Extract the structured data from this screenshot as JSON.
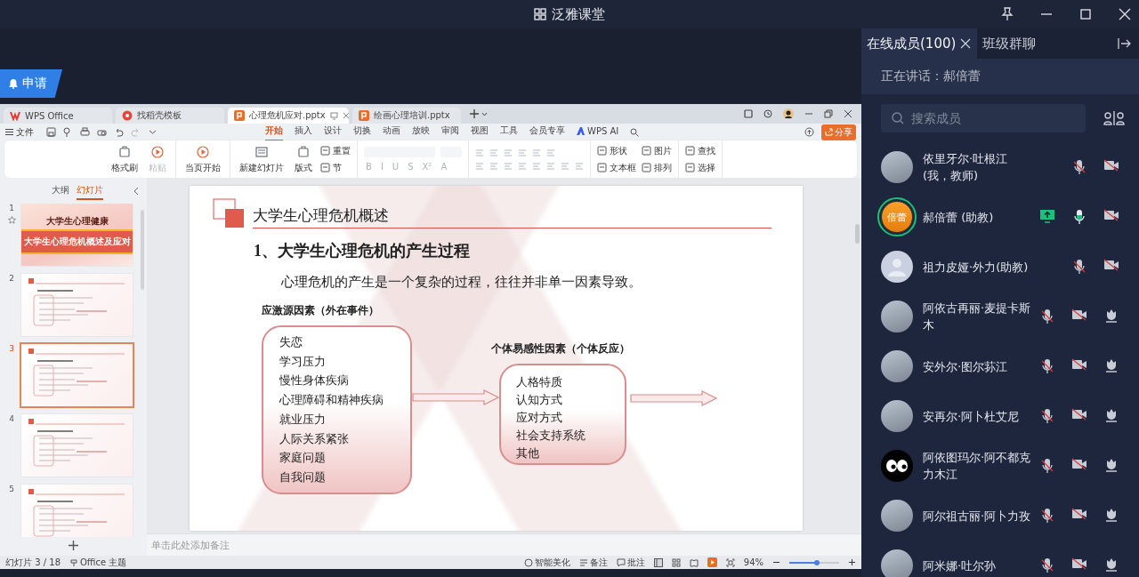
{
  "window": {
    "title": "泛雅课堂"
  },
  "apply_button": {
    "label": "申请"
  },
  "wps": {
    "tabs": [
      {
        "label": "WPS Office",
        "kind": "home",
        "selected": false
      },
      {
        "label": "找稻壳模板",
        "kind": "template",
        "selected": false
      },
      {
        "label": "心理危机应对.pptx",
        "kind": "pptx",
        "selected": true
      },
      {
        "label": "绘画心理培训.pptx",
        "kind": "pptx",
        "selected": false
      }
    ],
    "file_menu": {
      "label": "文件"
    },
    "ribbon_tabs": [
      {
        "label": "开始",
        "kind": "text",
        "selected": true
      },
      {
        "label": "插入",
        "kind": "text",
        "selected": false
      },
      {
        "label": "设计",
        "kind": "text",
        "selected": false
      },
      {
        "label": "切换",
        "kind": "text",
        "selected": false
      },
      {
        "label": "动画",
        "kind": "text",
        "selected": false
      },
      {
        "label": "放映",
        "kind": "text",
        "selected": false
      },
      {
        "label": "审阅",
        "kind": "text",
        "selected": false
      },
      {
        "label": "视图",
        "kind": "text",
        "selected": false
      },
      {
        "label": "工具",
        "kind": "text",
        "selected": false
      },
      {
        "label": "会员专享",
        "kind": "text",
        "selected": false
      },
      {
        "label": "WPS AI",
        "kind": "ai",
        "selected": false
      }
    ],
    "share_button": {
      "label": "分享"
    },
    "ribbon_groups": [
      {
        "kind": "tools",
        "items": [
          {
            "label": "格式刷",
            "kind": "large",
            "disabled": false
          },
          {
            "label": "粘贴",
            "kind": "large",
            "disabled": true
          }
        ]
      },
      {
        "kind": "tools",
        "items": [
          {
            "label": "当页开始",
            "kind": "large",
            "disabled": false
          }
        ]
      },
      {
        "kind": "tools",
        "items": [
          {
            "label": "新建幻灯片",
            "kind": "large",
            "disabled": false
          },
          {
            "label": "版式",
            "kind": "large",
            "disabled": false
          },
          {
            "label": "重置",
            "kind": "small",
            "disabled": false
          },
          {
            "label": "节",
            "kind": "small",
            "disabled": false
          }
        ]
      },
      {
        "kind": "font",
        "items": [
          {
            "label": "B",
            "kind": "glyph",
            "disabled": true
          },
          {
            "label": "I",
            "kind": "glyph",
            "disabled": true
          },
          {
            "label": "U",
            "kind": "glyph",
            "disabled": true
          },
          {
            "label": "S",
            "kind": "glyph",
            "disabled": true
          },
          {
            "label": "X²",
            "kind": "glyph",
            "disabled": true
          },
          {
            "label": "A",
            "kind": "glyph",
            "disabled": true
          }
        ]
      },
      {
        "kind": "paragraph"
      },
      {
        "kind": "tools",
        "items": [
          {
            "label": "形状",
            "kind": "small",
            "disabled": false
          },
          {
            "label": "文本框",
            "kind": "small",
            "disabled": false
          },
          {
            "label": "图片",
            "kind": "small",
            "disabled": false
          },
          {
            "label": "排列",
            "kind": "small",
            "disabled": false
          }
        ]
      },
      {
        "kind": "tools",
        "items": [
          {
            "label": "查找",
            "kind": "small",
            "disabled": false
          },
          {
            "label": "选择",
            "kind": "small",
            "disabled": false
          }
        ]
      }
    ],
    "panel_tabs": [
      {
        "label": "大纲",
        "selected": false
      },
      {
        "label": "幻灯片",
        "selected": true
      }
    ],
    "slides": [
      {
        "number": "1",
        "kind": "cover",
        "selected": false,
        "starred": true,
        "banner": "大学生心理健康",
        "title": "大学生心理危机概述及应对"
      },
      {
        "number": "2",
        "kind": "content",
        "selected": false,
        "starred": false
      },
      {
        "number": "3",
        "kind": "content",
        "selected": true,
        "starred": false
      },
      {
        "number": "4",
        "kind": "content",
        "selected": false,
        "starred": false
      },
      {
        "number": "5",
        "kind": "content",
        "selected": false,
        "starred": false
      }
    ],
    "slide": {
      "section_title": "大学生心理危机概述",
      "heading": "1、大学生心理危机的产生过程",
      "intro": "心理危机的产生是一个复杂的过程，往往并非单一因素导致。",
      "stressor_label": "应激源因素（外在事件）",
      "stressors": [
        "失恋",
        "学习压力",
        "慢性身体疾病",
        "心理障碍和精神疾病",
        "就业压力",
        "人际关系紧张",
        "家庭问题",
        "自我问题"
      ],
      "vulnerability_label": "个体易感性因素（个体反应）",
      "vulnerabilities": [
        "人格特质",
        "认知方式",
        "应对方式",
        "社会支持系统",
        "其他"
      ]
    },
    "notes": {
      "placeholder": "单击此处添加备注"
    },
    "status_bar": {
      "slide_counter": "幻灯片 3 / 18",
      "theme": "Office 主题",
      "beautify": "智能美化",
      "notes": "备注",
      "comments": "批注",
      "zoom": "94%",
      "zoom_slider": {
        "level": 0.55
      }
    }
  },
  "members_panel": {
    "tabs": [
      {
        "label": "在线成员(100)",
        "selected": true
      },
      {
        "label": "班级群聊",
        "selected": false
      }
    ],
    "speaking": "正在讲话：郝倍蕾",
    "search": {
      "placeholder": "搜索成员"
    },
    "members": [
      {
        "name": "依里牙尔·吐根江",
        "subtitle": "(我，教师)",
        "kind": "photo",
        "speaking": false,
        "sharing": false,
        "mic_on": false,
        "camera_on": false,
        "flower": false
      },
      {
        "name": "郝倍蕾 (助教)",
        "kind": "initials",
        "initials": "倍蕾",
        "speaking": true,
        "sharing": true,
        "mic_on": true,
        "camera_on": false,
        "flower": false
      },
      {
        "name": "祖力皮娅·外力(助教)",
        "kind": "silhouette",
        "speaking": false,
        "sharing": false,
        "mic_on": false,
        "camera_on": false,
        "flower": false
      },
      {
        "name": "阿依古再丽·麦提卡斯木",
        "kind": "photo",
        "speaking": false,
        "sharing": false,
        "mic_on": false,
        "camera_on": false,
        "flower": true
      },
      {
        "name": "安外尔·图尔荪江",
        "kind": "photo",
        "speaking": false,
        "sharing": false,
        "mic_on": false,
        "camera_on": false,
        "flower": true
      },
      {
        "name": "安再尔·阿卜杜艾尼",
        "kind": "photo",
        "speaking": false,
        "sharing": false,
        "mic_on": false,
        "camera_on": false,
        "flower": true
      },
      {
        "name": "阿依图玛尔·阿不都克力木江",
        "kind": "eyes",
        "speaking": false,
        "sharing": false,
        "mic_on": false,
        "camera_on": false,
        "flower": true
      },
      {
        "name": "阿尔祖古丽·阿卜力孜",
        "kind": "photo",
        "speaking": false,
        "sharing": false,
        "mic_on": false,
        "camera_on": false,
        "flower": true
      },
      {
        "name": "阿米娜·吐尔孙",
        "kind": "photo",
        "speaking": false,
        "sharing": false,
        "mic_on": false,
        "camera_on": false,
        "flower": true
      }
    ]
  }
}
